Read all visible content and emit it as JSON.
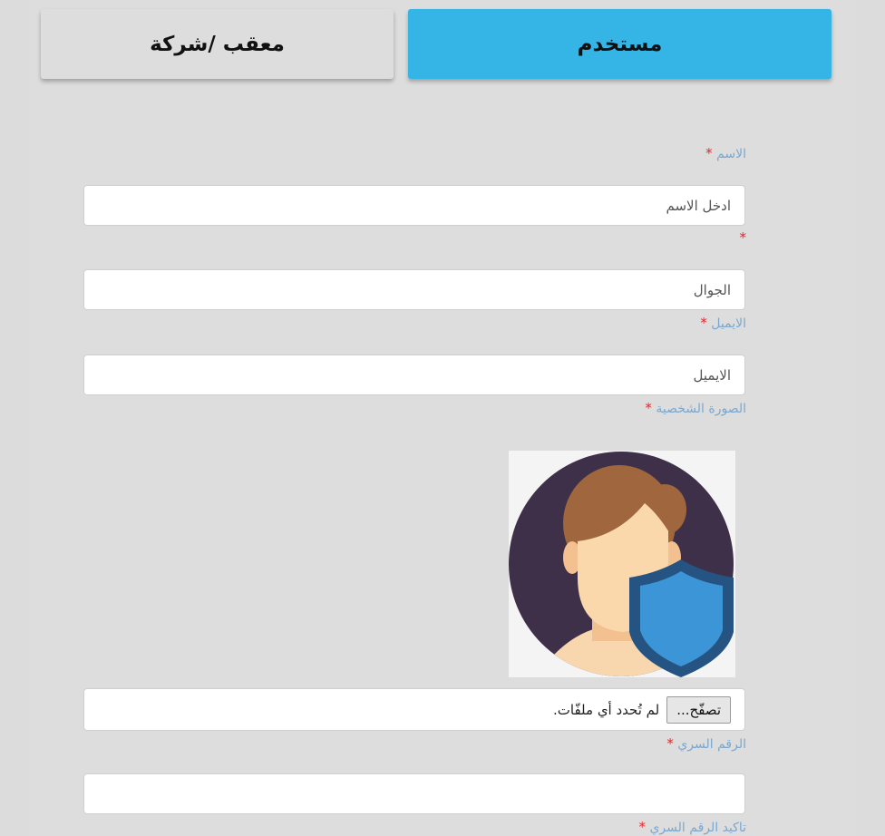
{
  "tabs": {
    "user": "مستخدم",
    "company": "معقب /شركة",
    "active": "user",
    "active_color": "#35b5e6"
  },
  "form": {
    "required_mark": "*",
    "required_color": "#e0262b",
    "label_color": "#7aa7cf",
    "name": {
      "label": "الاسم",
      "placeholder": "ادخل الاسم"
    },
    "mobile": {
      "label": "",
      "placeholder": "الجوال"
    },
    "email": {
      "label": "الايميل",
      "placeholder": "الايميل"
    },
    "photo": {
      "label": "الصورة الشخصية",
      "avatar_icon": "user-shield-avatar-icon",
      "browse_button": "تصفّح...",
      "file_status": "لم تُحدد أي ملفّات."
    },
    "password": {
      "label": "الرقم السري",
      "placeholder": ""
    },
    "confirm_password": {
      "label": "تاكيد الرقم السري"
    }
  }
}
